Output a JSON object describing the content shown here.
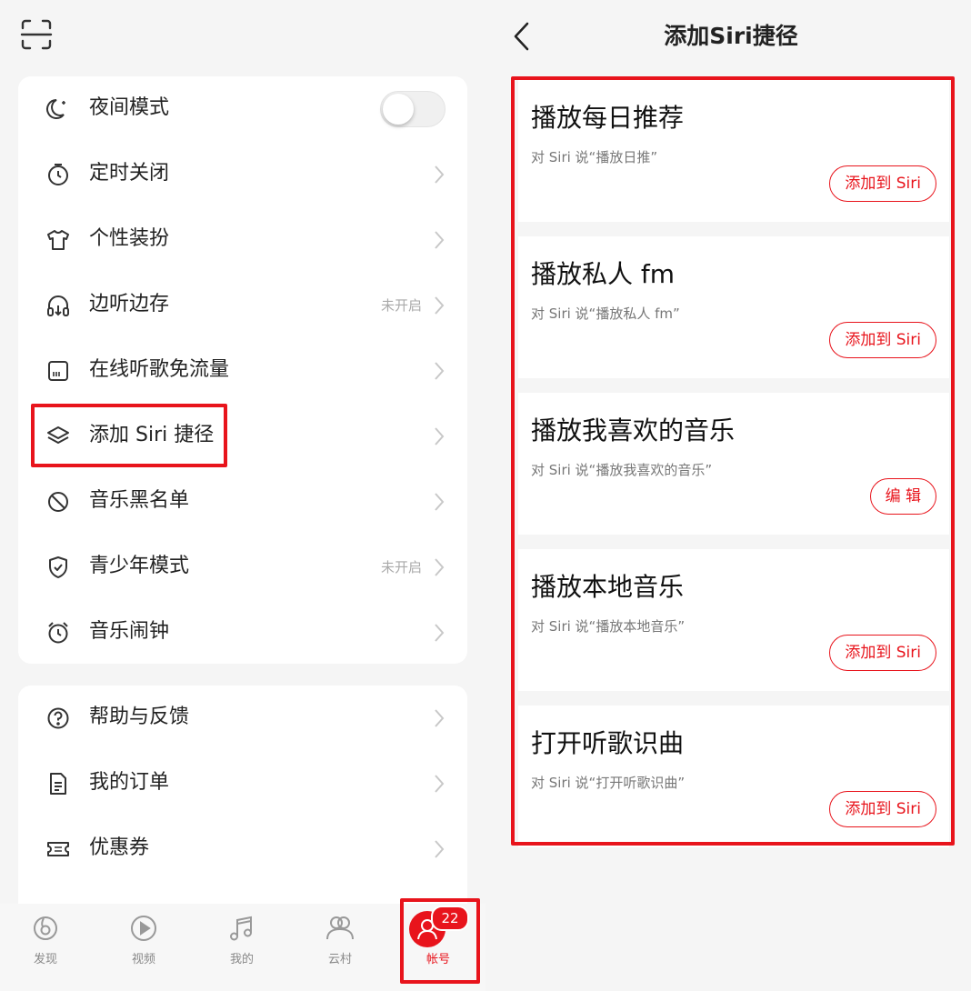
{
  "left_panel": {
    "scan_icon": "scan-icon",
    "settings_group1": [
      {
        "label": "夜间模式",
        "icon": "moon-icon",
        "type": "toggle",
        "on": false
      },
      {
        "label": "定时关闭",
        "icon": "timer-icon",
        "type": "link"
      },
      {
        "label": "个性装扮",
        "icon": "tshirt-icon",
        "type": "link"
      },
      {
        "label": "边听边存",
        "icon": "headphones-download-icon",
        "type": "link",
        "status": "未开启"
      },
      {
        "label": "在线听歌免流量",
        "icon": "sim-card-icon",
        "type": "link"
      },
      {
        "label": "添加 Siri 捷径",
        "icon": "layers-icon",
        "type": "link"
      },
      {
        "label": "音乐黑名单",
        "icon": "block-icon",
        "type": "link"
      },
      {
        "label": "青少年模式",
        "icon": "shield-check-icon",
        "type": "link",
        "status": "未开启"
      },
      {
        "label": "音乐闹钟",
        "icon": "alarm-clock-icon",
        "type": "link"
      }
    ],
    "settings_group2": [
      {
        "label": "帮助与反馈",
        "icon": "help-circle-icon",
        "type": "link"
      },
      {
        "label": "我的订单",
        "icon": "order-document-icon",
        "type": "link"
      },
      {
        "label": "优惠券",
        "icon": "coupon-icon",
        "type": "link"
      }
    ],
    "tab_bar": [
      {
        "label": "发现",
        "icon": "discover-icon"
      },
      {
        "label": "视频",
        "icon": "video-play-icon"
      },
      {
        "label": "我的",
        "icon": "music-note-icon"
      },
      {
        "label": "云村",
        "icon": "community-icon"
      },
      {
        "label": "帐号",
        "icon": "account-icon",
        "active": true,
        "badge": "22"
      }
    ]
  },
  "right_panel": {
    "title": "添加Siri捷径",
    "shortcuts": [
      {
        "title": "播放每日推荐",
        "subtitle": "对 Siri 说“播放日推”",
        "button": "添加到 Siri"
      },
      {
        "title": "播放私人 fm",
        "subtitle": "对 Siri 说“播放私人 fm”",
        "button": "添加到 Siri"
      },
      {
        "title": "播放我喜欢的音乐",
        "subtitle": "对 Siri 说“播放我喜欢的音乐”",
        "button": "编 辑"
      },
      {
        "title": "播放本地音乐",
        "subtitle": "对 Siri 说“播放本地音乐”",
        "button": "添加到 Siri"
      },
      {
        "title": "打开听歌识曲",
        "subtitle": "对 Siri 说“打开听歌识曲”",
        "button": "添加到 Siri"
      }
    ]
  },
  "colors": {
    "accent": "#e8141c",
    "background": "#f5f5f5",
    "card": "#ffffff",
    "muted_text": "#aaaaaa"
  }
}
